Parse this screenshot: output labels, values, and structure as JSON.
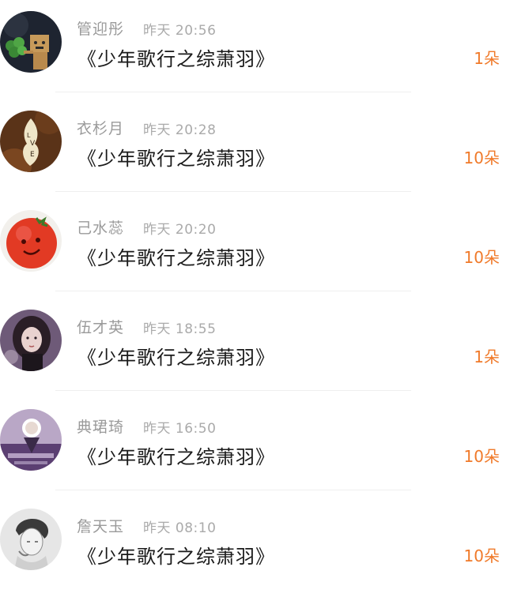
{
  "records": [
    {
      "name": "管迎彤",
      "time": "昨天 20:56",
      "title": "《少年歌行之综萧羽》",
      "count": "1朵",
      "avatar_icon": "robot-box-figure-icon"
    },
    {
      "name": "衣杉月",
      "time": "昨天 20:28",
      "title": "《少年歌行之综萧羽》",
      "count": "10朵",
      "avatar_icon": "love-leaf-icon"
    },
    {
      "name": "己水蕊",
      "time": "昨天 20:20",
      "title": "《少年歌行之综萧羽》",
      "count": "10朵",
      "avatar_icon": "tomato-face-icon"
    },
    {
      "name": "伍才英",
      "time": "昨天 18:55",
      "title": "《少年歌行之综萧羽》",
      "count": "1朵",
      "avatar_icon": "girl-portrait-icon"
    },
    {
      "name": "典珺琦",
      "time": "昨天 16:50",
      "title": "《少年歌行之综萧羽》",
      "count": "10朵",
      "avatar_icon": "purple-figure-icon"
    },
    {
      "name": "詹天玉",
      "time": "昨天 08:10",
      "title": "《少年歌行之综萧羽》",
      "count": "10朵",
      "avatar_icon": "sketch-portrait-icon"
    }
  ],
  "colors": {
    "name": "#9a9a9a",
    "time": "#aaaaaa",
    "title": "#1a1a1a",
    "count": "#f07a2a",
    "divider": "#efefef"
  }
}
